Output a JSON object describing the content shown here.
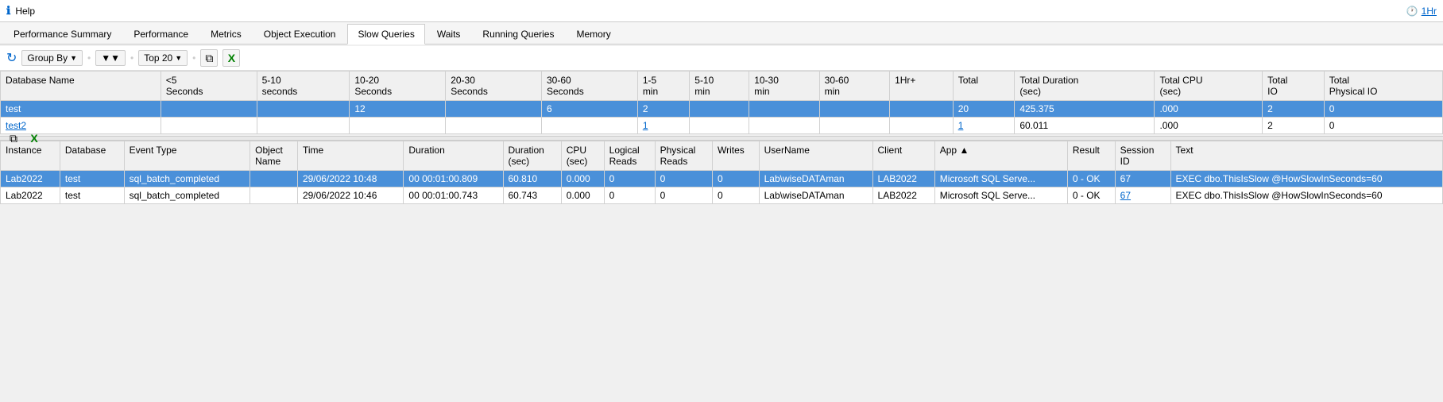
{
  "titlebar": {
    "help_label": "Help",
    "time_label": "1Hr"
  },
  "nav": {
    "tabs": [
      {
        "label": "Performance Summary",
        "active": false
      },
      {
        "label": "Performance",
        "active": false
      },
      {
        "label": "Metrics",
        "active": false
      },
      {
        "label": "Object Execution",
        "active": false
      },
      {
        "label": "Slow Queries",
        "active": true
      },
      {
        "label": "Waits",
        "active": false
      },
      {
        "label": "Running Queries",
        "active": false
      },
      {
        "label": "Memory",
        "active": false
      }
    ]
  },
  "top_toolbar": {
    "group_by_label": "Group By",
    "filter_label": "▼",
    "top_label": "Top 20"
  },
  "upper_table": {
    "headers": [
      "Database Name",
      "<5 Seconds",
      "5-10 seconds",
      "10-20 Seconds",
      "20-30 Seconds",
      "30-60 Seconds",
      "1-5 min",
      "5-10 min",
      "10-30 min",
      "30-60 min",
      "1Hr+",
      "Total",
      "Total Duration (sec)",
      "Total CPU (sec)",
      "Total IO",
      "Total Physical IO"
    ],
    "rows": [
      {
        "db_name": "test",
        "lt5": "",
        "s5_10": "",
        "s10_20": "12",
        "s20_30": "",
        "s30_60": "6",
        "m1_5": "2",
        "m5_10": "",
        "m10_30": "",
        "m30_60": "",
        "hr1plus": "",
        "total": "20",
        "total_duration": "425.375",
        "total_cpu": ".000",
        "total_io": "2",
        "total_pio": "0",
        "selected": true
      },
      {
        "db_name": "test2",
        "lt5": "",
        "s5_10": "",
        "s10_20": "",
        "s20_30": "",
        "s30_60": "",
        "m1_5": "1",
        "m5_10": "",
        "m10_30": "",
        "m30_60": "",
        "hr1plus": "",
        "total": "1",
        "total_duration": "60.011",
        "total_cpu": ".000",
        "total_io": "2",
        "total_pio": "0",
        "selected": false
      }
    ]
  },
  "bottom_table": {
    "headers": [
      "Instance",
      "Database",
      "Event Type",
      "Object Name",
      "Time",
      "Duration",
      "Duration (sec)",
      "CPU (sec)",
      "Logical Reads",
      "Physical Reads",
      "Writes",
      "UserName",
      "Client",
      "App",
      "Result",
      "Session ID",
      "Text"
    ],
    "rows": [
      {
        "instance": "Lab2022",
        "database": "test",
        "event_type": "sql_batch_completed",
        "object_name": "",
        "time": "29/06/2022 10:48",
        "duration": "00 00:01:00.809",
        "duration_sec": "60.810",
        "cpu_sec": "0.000",
        "logical_reads": "0",
        "physical_reads": "0",
        "writes": "0",
        "username": "Lab\\wiseDATAman",
        "client": "LAB2022",
        "app": "Microsoft SQL Serve...",
        "result": "0 - OK",
        "session_id": "67",
        "text": "EXEC dbo.ThisIsSlow @HowSlowInSeconds=60",
        "selected": true
      },
      {
        "instance": "Lab2022",
        "database": "test",
        "event_type": "sql_batch_completed",
        "object_name": "",
        "time": "29/06/2022 10:46",
        "duration": "00 00:01:00.743",
        "duration_sec": "60.743",
        "cpu_sec": "0.000",
        "logical_reads": "0",
        "physical_reads": "0",
        "writes": "0",
        "username": "Lab\\wiseDATAman",
        "client": "LAB2022",
        "app": "Microsoft SQL Serve...",
        "result": "0 - OK",
        "session_id": "67",
        "text": "EXEC dbo.ThisIsSlow @HowSlowInSeconds=60",
        "selected": false
      }
    ],
    "app_sort": "▲"
  },
  "icons": {
    "help": "ℹ",
    "clock": "🕐",
    "refresh": "↻",
    "copy": "⧉",
    "excel": "📊",
    "filter": "▼"
  }
}
